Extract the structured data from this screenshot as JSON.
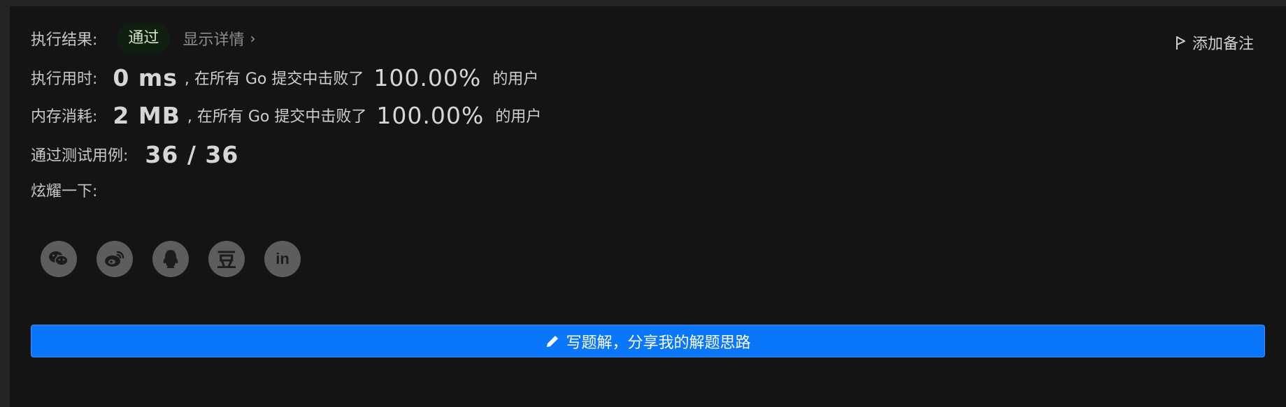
{
  "result": {
    "label": "执行结果:",
    "status": "通过",
    "details_link": "显示详情",
    "add_note": "添加备注"
  },
  "runtime": {
    "label": "执行用时:",
    "value": "0 ms",
    "text_before": ", 在所有 Go 提交中击败了",
    "percent": "100.00%",
    "text_after": "的用户"
  },
  "memory": {
    "label": "内存消耗:",
    "value": "2 MB",
    "text_before": ", 在所有 Go 提交中击败了",
    "percent": "100.00%",
    "text_after": "的用户"
  },
  "tests": {
    "label": "通过测试用例:",
    "value": "36 / 36"
  },
  "share": {
    "label": "炫耀一下:",
    "icons": [
      "wechat-icon",
      "weibo-icon",
      "qq-icon",
      "douban-icon",
      "linkedin-icon"
    ],
    "douban_glyph": "豆",
    "linkedin_glyph": "in"
  },
  "write_solution": {
    "label": "写题解，分享我的解题思路"
  },
  "colors": {
    "background": "#141414",
    "accent": "#0a77fb",
    "success_badge_bg": "#102010"
  }
}
